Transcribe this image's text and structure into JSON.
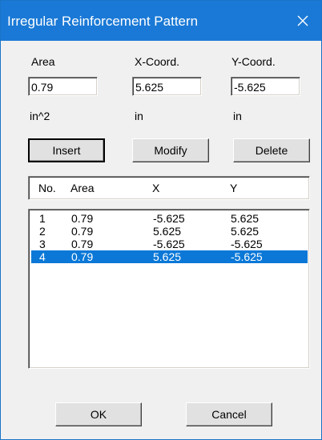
{
  "window": {
    "title": "Irregular Reinforcement Pattern"
  },
  "labels": {
    "area": "Area",
    "x_coord": "X-Coord.",
    "y_coord": "Y-Coord.",
    "area_unit": "in^2",
    "x_unit": "in",
    "y_unit": "in"
  },
  "fields": {
    "area": "0.79",
    "x": "5.625",
    "y": "-5.625"
  },
  "buttons": {
    "insert": "Insert",
    "modify": "Modify",
    "delete": "Delete",
    "ok": "OK",
    "cancel": "Cancel"
  },
  "list": {
    "headers": [
      "No.",
      "Area",
      "X",
      "Y"
    ],
    "rows": [
      {
        "no": "1",
        "area": "0.79",
        "x": "-5.625",
        "y": "5.625",
        "selected": false
      },
      {
        "no": "2",
        "area": "0.79",
        "x": "5.625",
        "y": "5.625",
        "selected": false
      },
      {
        "no": "3",
        "area": "0.79",
        "x": "-5.625",
        "y": "-5.625",
        "selected": false
      },
      {
        "no": "4",
        "area": "0.79",
        "x": "5.625",
        "y": "-5.625",
        "selected": true
      }
    ]
  },
  "colors": {
    "title_bar": "#1a79d6",
    "selection": "#0b78d7",
    "dialog_bg": "#f0f0f0"
  },
  "icons": {
    "close": "close-icon"
  }
}
